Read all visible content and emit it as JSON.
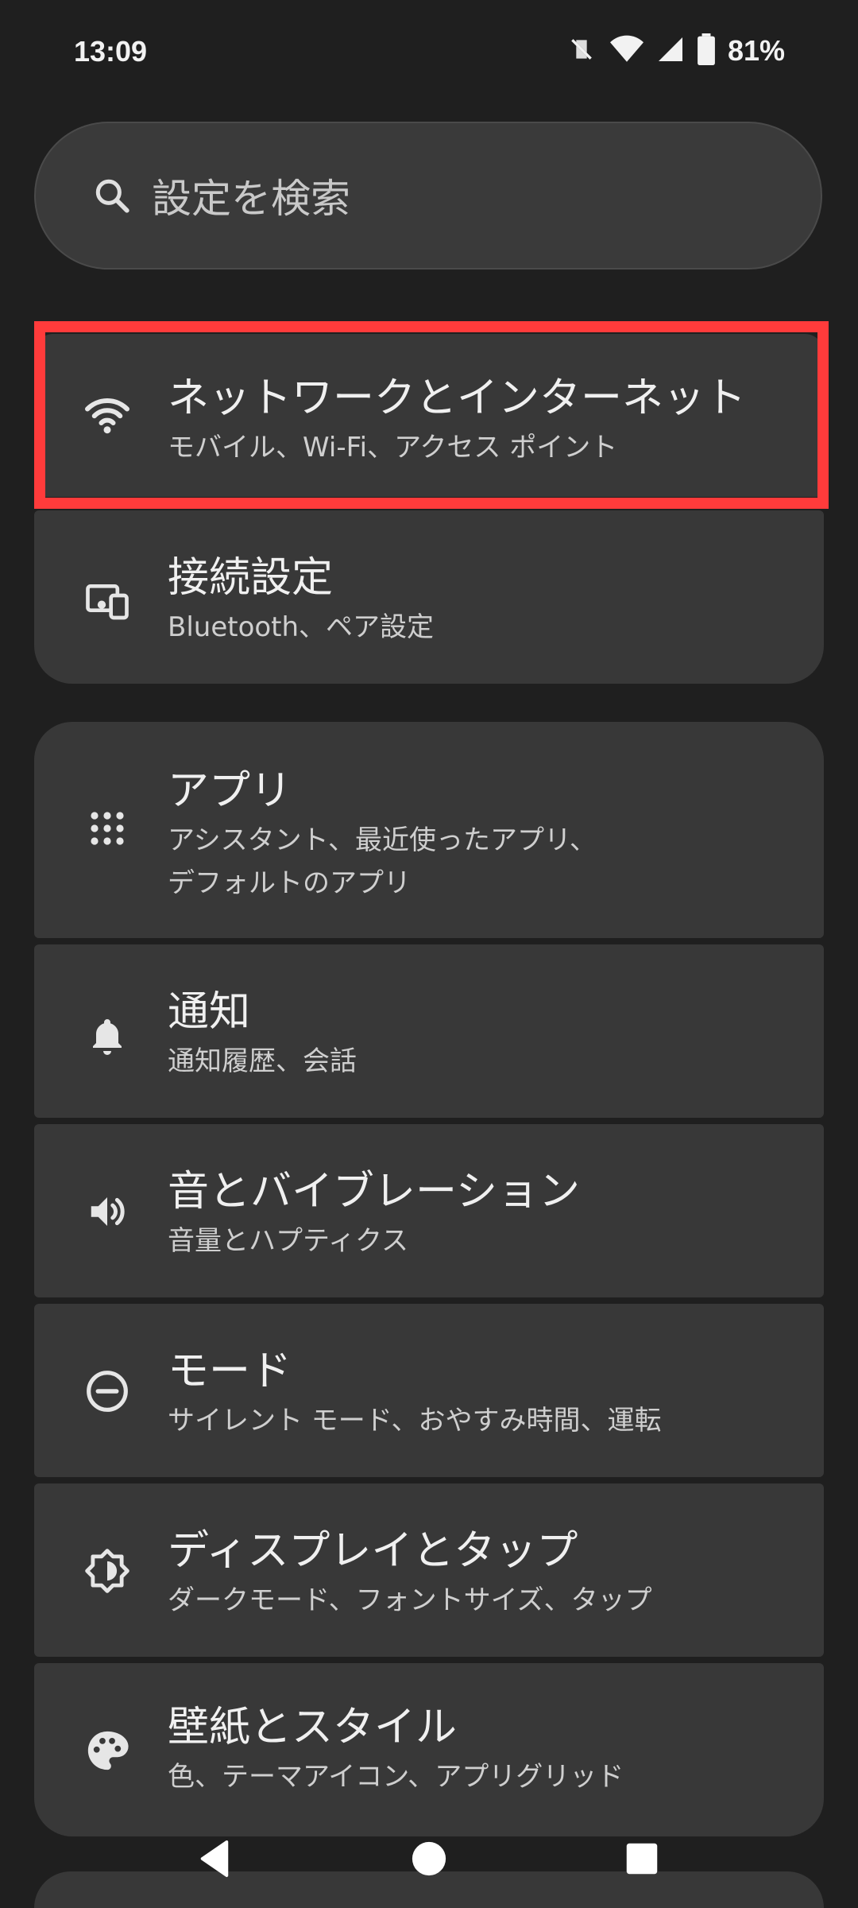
{
  "status_bar": {
    "time": "13:09",
    "battery": "81%",
    "icons": [
      "vibrate-off-icon",
      "wifi-icon",
      "signal-icon",
      "battery-icon"
    ]
  },
  "search": {
    "placeholder": "設定を検索"
  },
  "items": [
    {
      "title": "ネットワークとインターネット",
      "subtitle": "モバイル、Wi-Fi、アクセス ポイント",
      "icon": "wifi-icon"
    },
    {
      "title": "接続設定",
      "subtitle": "Bluetooth、ペア設定",
      "icon": "connected-devices-icon"
    },
    {
      "title": "アプリ",
      "subtitle": "アシスタント、最近使ったアプリ、",
      "subtitle2": "デフォルトのアプリ",
      "icon": "apps-grid-icon"
    },
    {
      "title": "通知",
      "subtitle": "通知履歴、会話",
      "icon": "bell-icon"
    },
    {
      "title": "音とバイブレーション",
      "subtitle": "音量とハプティクス",
      "icon": "volume-icon"
    },
    {
      "title": "モード",
      "subtitle": "サイレント モード、おやすみ時間、運転",
      "icon": "do-not-disturb-icon"
    },
    {
      "title": "ディスプレイとタップ",
      "subtitle": "ダークモード、フォントサイズ、タップ",
      "icon": "brightness-icon"
    },
    {
      "title": "壁紙とスタイル",
      "subtitle": "色、テーマアイコン、アプリグリッド",
      "icon": "palette-icon"
    }
  ],
  "colors": {
    "background": "#1f1f1f",
    "card": "#383838",
    "highlight": "#ff3b3b"
  },
  "nav": [
    "back-icon",
    "home-icon",
    "recents-icon"
  ]
}
